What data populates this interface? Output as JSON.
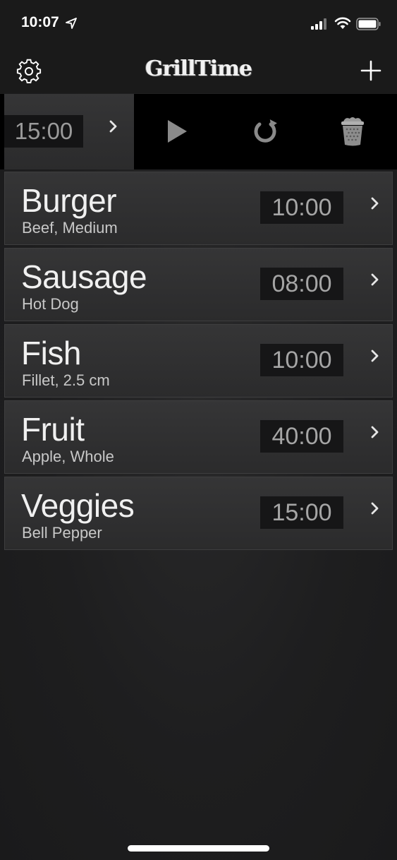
{
  "status_bar": {
    "time": "10:07",
    "icons": [
      "location-arrow-icon",
      "cellular-signal-icon",
      "wifi-icon",
      "battery-icon"
    ]
  },
  "nav": {
    "title": "GrillTime",
    "left_icon": "gear-icon",
    "right_icon": "plus-icon"
  },
  "swiped_row": {
    "timer": "15:00",
    "actions": [
      "play-icon",
      "reset-icon",
      "trash-icon"
    ]
  },
  "timers": [
    {
      "name": "Burger",
      "detail": "Beef, Medium",
      "time": "10:00"
    },
    {
      "name": "Sausage",
      "detail": "Hot Dog",
      "time": "08:00"
    },
    {
      "name": "Fish",
      "detail": "Fillet, 2.5 cm",
      "time": "10:00"
    },
    {
      "name": "Fruit",
      "detail": "Apple, Whole",
      "time": "40:00"
    },
    {
      "name": "Veggies",
      "detail": "Bell Pepper",
      "time": "15:00"
    }
  ],
  "colors": {
    "background": "#1e1e1f",
    "row": "#303031",
    "timer_box": "#161617",
    "action_bar": "#000000"
  }
}
